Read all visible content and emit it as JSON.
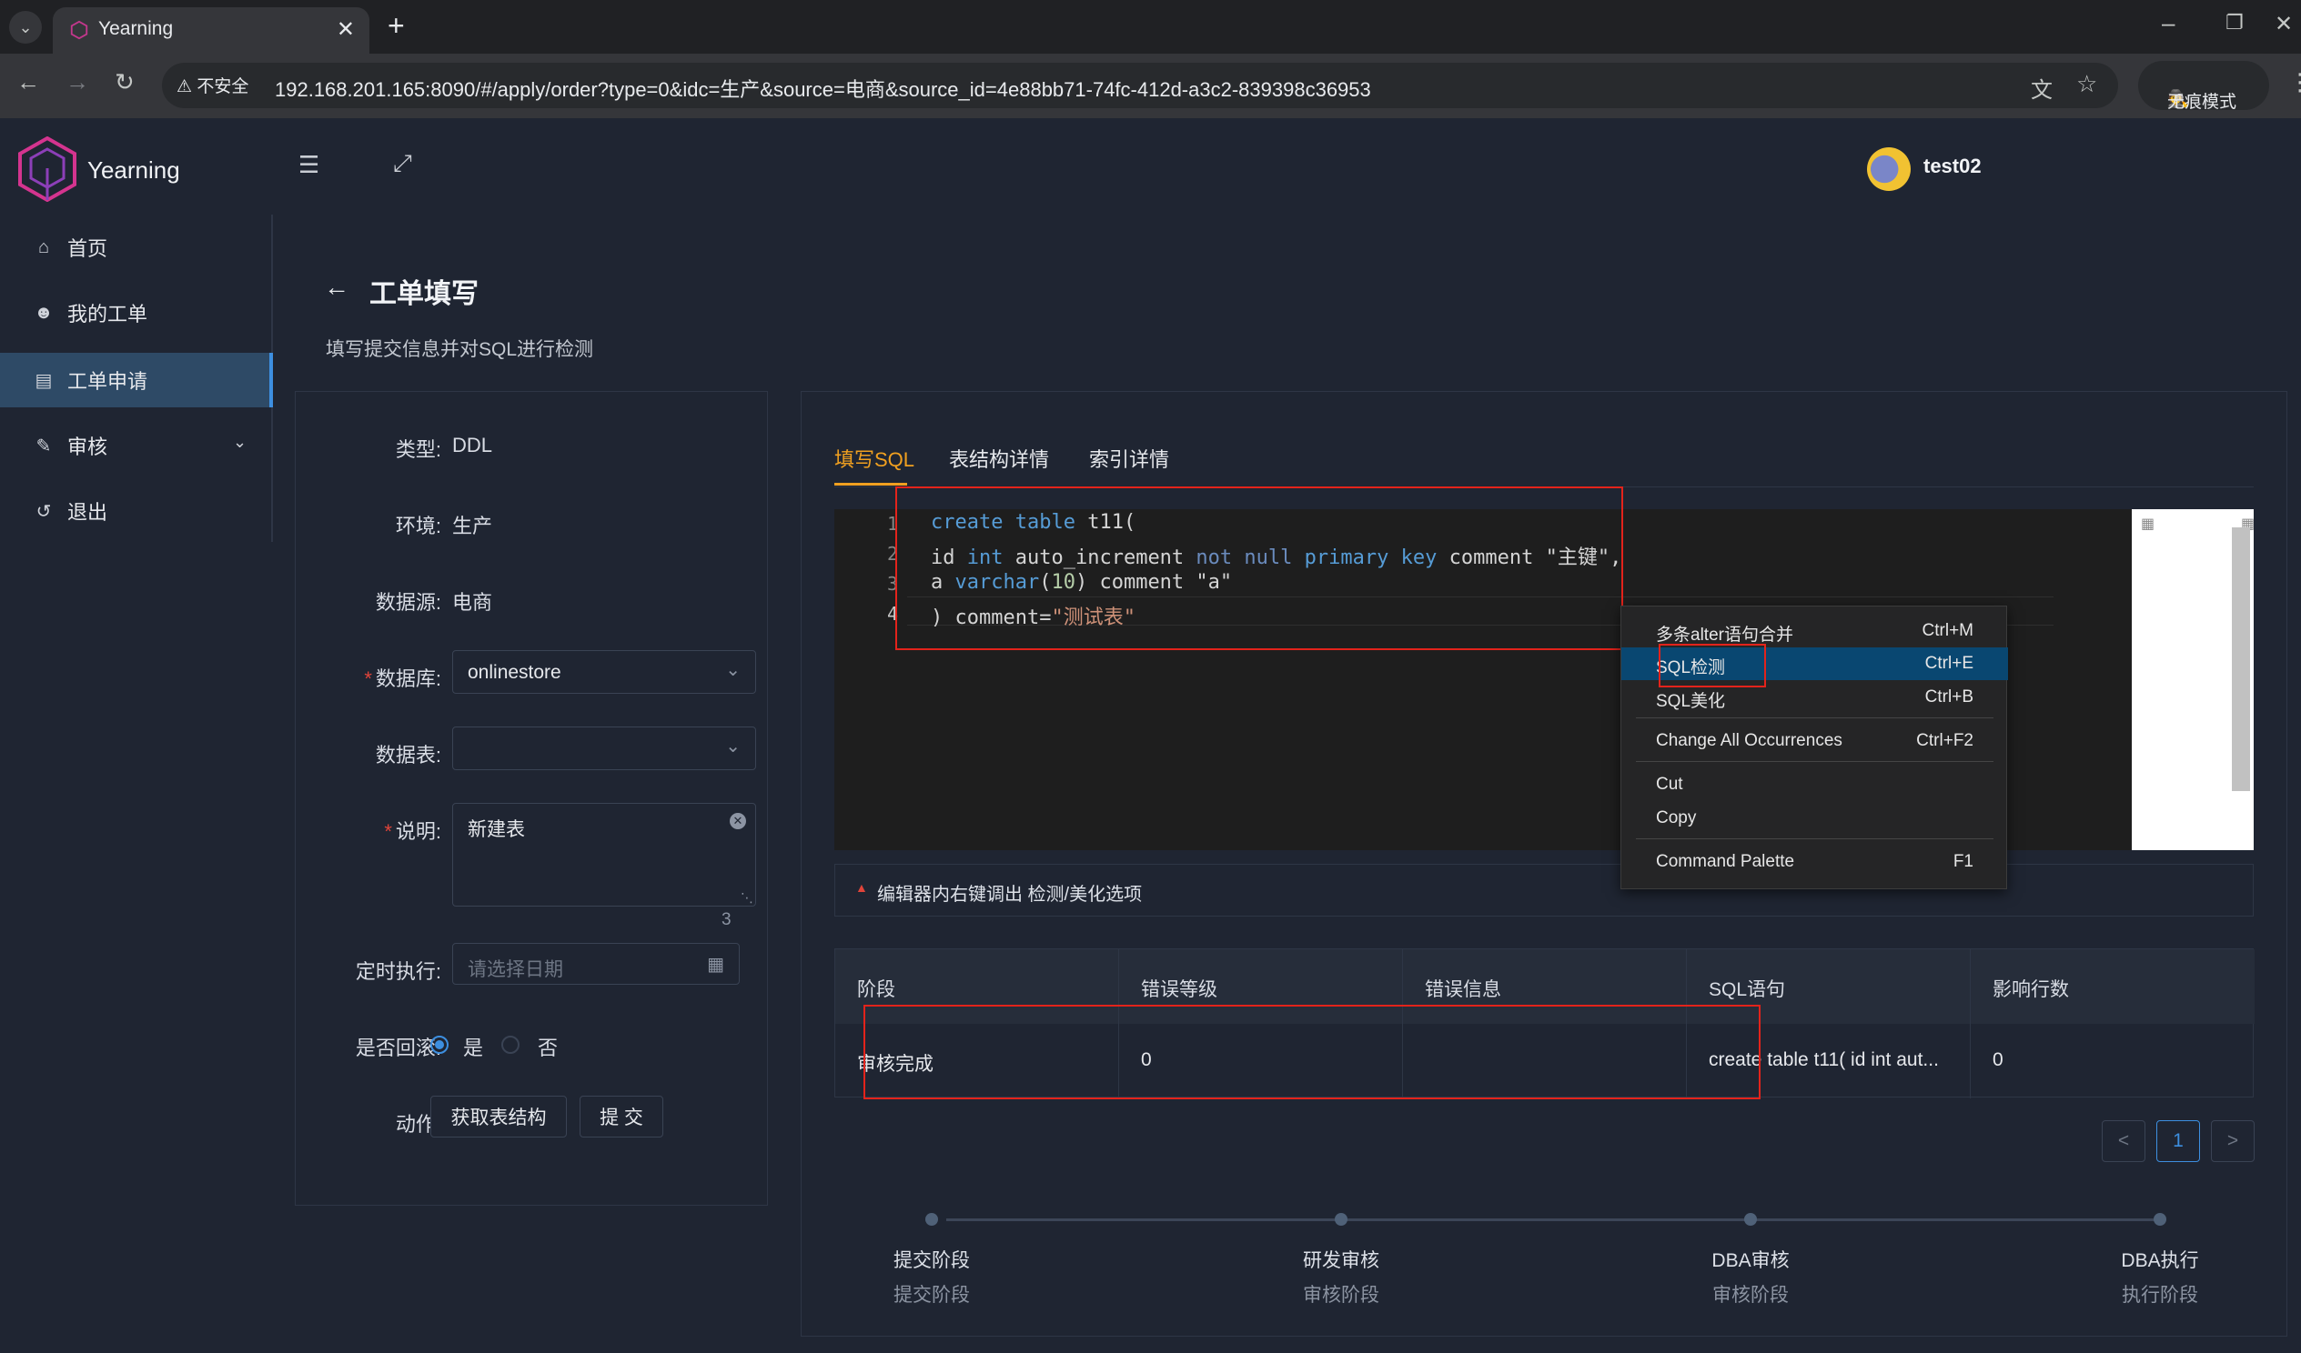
{
  "browser": {
    "tab_title": "Yearning",
    "new_tab": "+",
    "security_label": "不安全",
    "url": "192.168.201.165:8090/#/apply/order?type=0&idc=生产&source=电商&source_id=4e88bb71-74fc-412d-a3c2-839398c36953",
    "incognito_label": "无痕模式"
  },
  "app": {
    "logo_text": "Yearning",
    "username": "test02"
  },
  "sidebar": {
    "items": [
      {
        "label": "首页",
        "icon": "home-icon"
      },
      {
        "label": "我的工单",
        "icon": "user-icon"
      },
      {
        "label": "工单申请",
        "icon": "desktop-icon",
        "active": true
      },
      {
        "label": "审核",
        "icon": "audit-icon",
        "expandable": true
      },
      {
        "label": "退出",
        "icon": "logout-icon"
      }
    ]
  },
  "page": {
    "title": "工单填写",
    "subtitle": "填写提交信息并对SQL进行检测"
  },
  "form": {
    "type_label": "类型:",
    "type_value": "DDL",
    "env_label": "环境:",
    "env_value": "生产",
    "source_label": "数据源:",
    "source_value": "电商",
    "db_label": "数据库:",
    "db_value": "onlinestore",
    "table_label": "数据表:",
    "table_value": "",
    "desc_label": "说明:",
    "desc_value": "新建表",
    "desc_count": "3",
    "schedule_label": "定时执行:",
    "schedule_placeholder": "请选择日期",
    "rollback_label": "是否回滚:",
    "rollback_yes": "是",
    "rollback_no": "否",
    "action_label": "动作:",
    "fetch_button": "获取表结构",
    "submit_button": "提 交"
  },
  "tabs": [
    "填写SQL",
    "表结构详情",
    "索引详情"
  ],
  "editor": {
    "line_numbers": [
      "1",
      "2",
      "3",
      "4"
    ],
    "hint": "编辑器内右键调出 检测/美化选项"
  },
  "context_menu": {
    "items": [
      {
        "label": "多条alter语句合并",
        "shortcut": "Ctrl+M"
      },
      {
        "label": "SQL检测",
        "shortcut": "Ctrl+E",
        "selected": true
      },
      {
        "label": "SQL美化",
        "shortcut": "Ctrl+B"
      },
      {
        "label": "Change All Occurrences",
        "shortcut": "Ctrl+F2"
      },
      {
        "label": "Cut",
        "shortcut": ""
      },
      {
        "label": "Copy",
        "shortcut": ""
      },
      {
        "label": "Command Palette",
        "shortcut": "F1"
      }
    ]
  },
  "results": {
    "headers": [
      "阶段",
      "错误等级",
      "错误信息",
      "SQL语句",
      "影响行数"
    ],
    "row": [
      "审核完成",
      "0",
      "",
      "create table t11( id int aut...",
      "0"
    ]
  },
  "pagination": {
    "prev": "<",
    "page": "1",
    "next": ">"
  },
  "steps": [
    {
      "title": "提交阶段",
      "desc": "提交阶段"
    },
    {
      "title": "研发审核",
      "desc": "审核阶段"
    },
    {
      "title": "DBA审核",
      "desc": "审核阶段"
    },
    {
      "title": "DBA执行",
      "desc": "执行阶段"
    }
  ],
  "colors": {
    "accent": "#3d8fe0",
    "tab_active": "#f0a020",
    "annotation_red": "#e3231b",
    "menu_selected": "#094771"
  }
}
